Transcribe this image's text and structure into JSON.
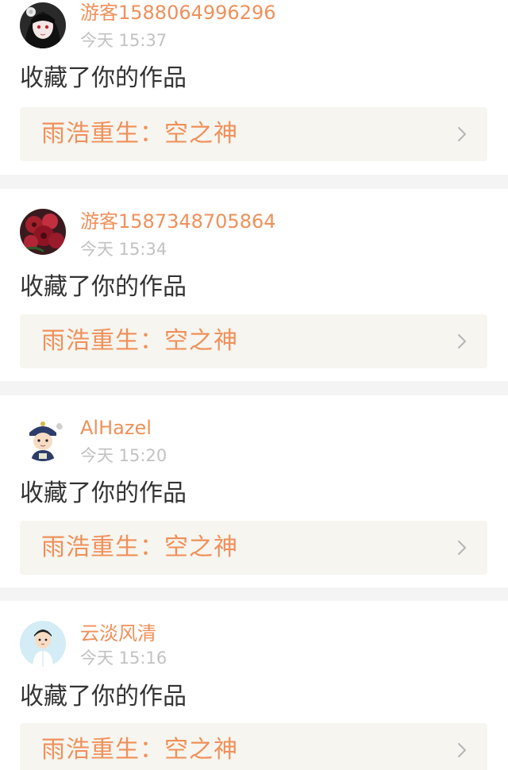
{
  "feed": {
    "items": [
      {
        "username": "游客1588064996296",
        "timestamp": "今天 15:37",
        "action": "收藏了你的作品",
        "work_title": "雨浩重生：空之神",
        "avatar_icon": "anime-girl-avatar"
      },
      {
        "username": "游客1587348705864",
        "timestamp": "今天 15:34",
        "action": "收藏了你的作品",
        "work_title": "雨浩重生：空之神",
        "avatar_icon": "red-flowers-avatar"
      },
      {
        "username": "AlHazel",
        "timestamp": "今天 15:20",
        "action": "收藏了你的作品",
        "work_title": "雨浩重生：空之神",
        "avatar_icon": "cartoon-official-avatar"
      },
      {
        "username": "云淡风清",
        "timestamp": "今天 15:16",
        "action": "收藏了你的作品",
        "work_title": "雨浩重生：空之神",
        "avatar_icon": "cartoon-boy-avatar"
      }
    ]
  },
  "colors": {
    "accent": "#f0905a",
    "timestamp": "#c2c2c2",
    "body_text": "#333333",
    "link_bg": "#f6f5ef",
    "separator": "#f4f4f4"
  }
}
